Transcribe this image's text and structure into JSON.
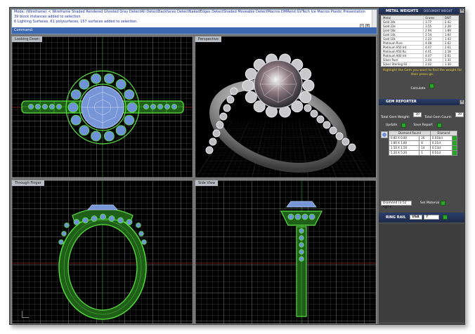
{
  "command": {
    "lines": [
      "Mode: (Wireframe) < Wireframe  Shaded  Rendered  Ghosted  Gray  DetectAll  DetectBackfaces  DetectNakedEdges  DetectShaded  Moveable  DetectMacros  DMRend  GVTech  Ice  Macros  Plastic  Presentation",
      "39 block instances added to selection",
      "6 Lighting Surfaces, 61 polysurfaces, 157 surfaces added to selection."
    ],
    "prompt": "Command:"
  },
  "viewports": {
    "top_left": "Looking Down",
    "top_right": "Perspective",
    "bottom_left": "Through Finger",
    "bottom_right": "Side View"
  },
  "metal_weights": {
    "title": "METAL WEIGHTS",
    "subtitle": "DOCUMENT WEIGHT",
    "headers": [
      "Metal",
      "Grams",
      "DWT"
    ],
    "rows": [
      [
        "Gold 24k",
        "3.77",
        "2.42"
      ],
      [
        "Gold 22k",
        "3.55",
        "2.28"
      ],
      [
        "Gold 18k",
        "2.94",
        "1.89"
      ],
      [
        "Gold 14k",
        "2.54",
        "1.64"
      ],
      [
        "Gold 10k",
        "2.23",
        "1.43"
      ],
      [
        "Platinum Pure",
        "4.08",
        "2.62"
      ],
      [
        "Platinum 950 Ird",
        "4.07",
        "2.61"
      ],
      [
        "Platinum 950 Ru",
        "4.01",
        "2.58"
      ],
      [
        "Platinum 900 Ird",
        "4.07",
        "2.61"
      ],
      [
        "Silver Pure",
        "2.04",
        "1.31"
      ],
      [
        "Silver Sterling 92",
        "2.02",
        "1.30"
      ]
    ],
    "hint": "Highlight the Gem you want to find the weight for then press go.",
    "calculate": "Calculate"
  },
  "gem_reporter": {
    "title": "GEM REPORTER",
    "total_weight_label": "Total Gem Weight:",
    "total_weight": "30",
    "total_count_label": "Total Gem Count:",
    "total_count": "39",
    "update": "Update",
    "save_report": "Save Report",
    "shape_label": "Diamond Round",
    "stone_label": "Diamond",
    "rows": [
      [
        "0.80 X 0.80",
        "26",
        "0.010ct"
      ],
      [
        "1.80 X 1.80",
        "8",
        "0.21ct"
      ],
      [
        "1.50 X 1.50",
        "14",
        "0.13ct"
      ],
      [
        "5.20 X 5.20",
        "1",
        "0.51ct"
      ]
    ],
    "material_select": "Diamond",
    "material_value": "(3.52 sgi)",
    "set_material": "Set Material"
  },
  "ring_rail": {
    "title": "RING RAIL",
    "size_system": "USA",
    "size": "7"
  },
  "colors": {
    "panel_bg": "#4a4a4a",
    "title_bar": "#1d2a4a",
    "wire_green": "#58e040",
    "gem_blue": "#6f92d8",
    "hint_yellow": "#f0d23a"
  }
}
